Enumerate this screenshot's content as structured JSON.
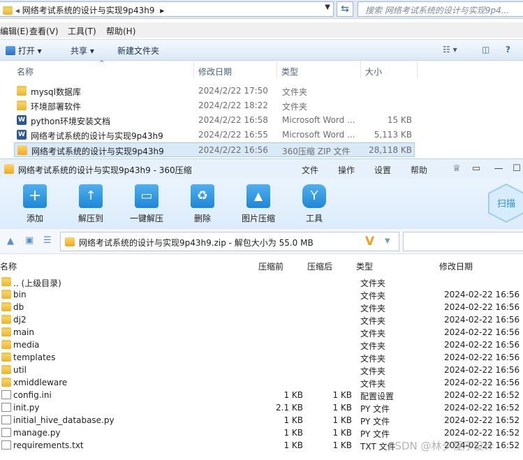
{
  "explorer": {
    "address": "网络考试系统的设计与实现9p43h9",
    "search_placeholder": "搜索 网络考试系统的设计与实现9p4...",
    "menu": [
      "编辑(E)",
      "查看(V)",
      "工具(T)",
      "帮助(H)"
    ],
    "commands": [
      "打开",
      "共享",
      "新建文件夹"
    ],
    "columns": [
      "名称",
      "修改日期",
      "类型",
      "大小"
    ],
    "rows": [
      {
        "name": "mysql数据库",
        "date": "2024/2/22 17:50",
        "type": "文件夹",
        "size": "",
        "icon": "folder-icon"
      },
      {
        "name": "环境部署软件",
        "date": "2024/2/22 18:22",
        "type": "文件夹",
        "size": "",
        "icon": "folder-icon"
      },
      {
        "name": "python环境安装文档",
        "date": "2024/2/22 16:58",
        "type": "Microsoft Word ...",
        "size": "15 KB",
        "icon": "word-icon"
      },
      {
        "name": "网络考试系统的设计与实现9p43h9",
        "date": "2024/2/22 16:55",
        "type": "Microsoft Word ...",
        "size": "5,113 KB",
        "icon": "word-icon"
      },
      {
        "name": "网络考试系统的设计与实现9p43h9",
        "date": "2024/2/22 16:56",
        "type": "360压缩 ZIP 文件",
        "size": "28,118 KB",
        "icon": "zip-icon"
      }
    ]
  },
  "zip": {
    "title": "网络考试系统的设计与实现9p43h9 - 360压缩",
    "menu": [
      "文件",
      "操作",
      "设置",
      "帮助"
    ],
    "tools": [
      "添加",
      "解压到",
      "一键解压",
      "删除",
      "图片压缩",
      "工具"
    ],
    "scan_label": "扫描",
    "path": "网络考试系统的设计与实现9p43h9.zip - 解包大小为 55.0 MB",
    "columns": [
      "名称",
      "压缩前",
      "压缩后",
      "类型",
      "修改日期"
    ],
    "rows": [
      {
        "name": ".. (上级目录)",
        "before": "",
        "after": "",
        "type": "文件夹",
        "date": "",
        "icon": "folder-icon"
      },
      {
        "name": "bin",
        "before": "",
        "after": "",
        "type": "文件夹",
        "date": "2024-02-22 16:56",
        "icon": "folder-icon"
      },
      {
        "name": "db",
        "before": "",
        "after": "",
        "type": "文件夹",
        "date": "2024-02-22 16:56",
        "icon": "folder-icon"
      },
      {
        "name": "dj2",
        "before": "",
        "after": "",
        "type": "文件夹",
        "date": "2024-02-22 16:56",
        "icon": "folder-icon"
      },
      {
        "name": "main",
        "before": "",
        "after": "",
        "type": "文件夹",
        "date": "2024-02-22 16:56",
        "icon": "folder-icon"
      },
      {
        "name": "media",
        "before": "",
        "after": "",
        "type": "文件夹",
        "date": "2024-02-22 16:56",
        "icon": "folder-icon"
      },
      {
        "name": "templates",
        "before": "",
        "after": "",
        "type": "文件夹",
        "date": "2024-02-22 16:56",
        "icon": "folder-icon"
      },
      {
        "name": "util",
        "before": "",
        "after": "",
        "type": "文件夹",
        "date": "2024-02-22 16:56",
        "icon": "folder-icon"
      },
      {
        "name": "xmiddleware",
        "before": "",
        "after": "",
        "type": "文件夹",
        "date": "2024-02-22 16:56",
        "icon": "folder-icon"
      },
      {
        "name": "config.ini",
        "before": "1 KB",
        "after": "1 KB",
        "type": "配置设置",
        "date": "2024-02-22 16:52",
        "icon": "config-file-icon"
      },
      {
        "name": "init.py",
        "before": "2.1 KB",
        "after": "1 KB",
        "type": "PY 文件",
        "date": "2024-02-22 16:52",
        "icon": "file-icon"
      },
      {
        "name": "initial_hive_database.py",
        "before": "1 KB",
        "after": "1 KB",
        "type": "PY 文件",
        "date": "2024-02-22 16:52",
        "icon": "file-icon"
      },
      {
        "name": "manage.py",
        "before": "1 KB",
        "after": "1 KB",
        "type": "PY 文件",
        "date": "2024-02-22 16:52",
        "icon": "file-icon"
      },
      {
        "name": "requirements.txt",
        "before": "1 KB",
        "after": "1 KB",
        "type": "TXT 文件",
        "date": "2024-02-22 16:52",
        "icon": "file-icon"
      }
    ]
  },
  "watermark": "CSDN @林夕程序设计"
}
